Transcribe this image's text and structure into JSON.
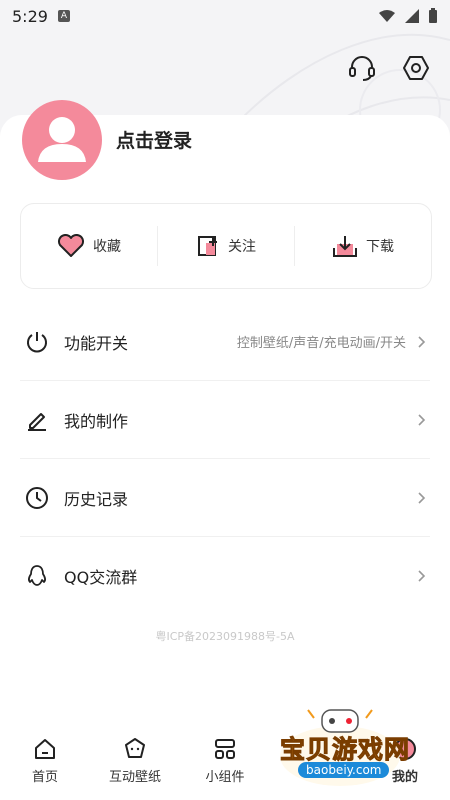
{
  "status": {
    "time": "5:29",
    "a_badge": "A"
  },
  "profile": {
    "login_text": "点击登录"
  },
  "quick_actions": [
    {
      "label": "收藏",
      "icon": "heart-icon"
    },
    {
      "label": "关注",
      "icon": "follow-add-icon"
    },
    {
      "label": "下载",
      "icon": "download-icon"
    }
  ],
  "menu": [
    {
      "label": "功能开关",
      "sub": "控制壁纸/声音/充电动画/开关",
      "icon": "power-icon"
    },
    {
      "label": "我的制作",
      "sub": "",
      "icon": "pen-icon"
    },
    {
      "label": "历史记录",
      "sub": "",
      "icon": "clock-icon"
    },
    {
      "label": "QQ交流群",
      "sub": "",
      "icon": "qq-penguin-icon"
    }
  ],
  "icp": "粤ICP备2023091988号-5A",
  "tabs": [
    {
      "label": "首页",
      "icon": "home-icon"
    },
    {
      "label": "互动壁纸",
      "icon": "interactive-wallpaper-icon"
    },
    {
      "label": "小组件",
      "icon": "widgets-icon"
    },
    {
      "label": "",
      "icon": "tab-icon-hidden"
    },
    {
      "label": "我的",
      "icon": "profile-tab-icon"
    }
  ],
  "watermark": {
    "text": "宝贝游戏网",
    "url": "baobeiy.com"
  },
  "colors": {
    "accent_pink": "#f48a9b",
    "watermark_orange": "#f29a1c",
    "watermark_blue": "#1c8ad9"
  }
}
